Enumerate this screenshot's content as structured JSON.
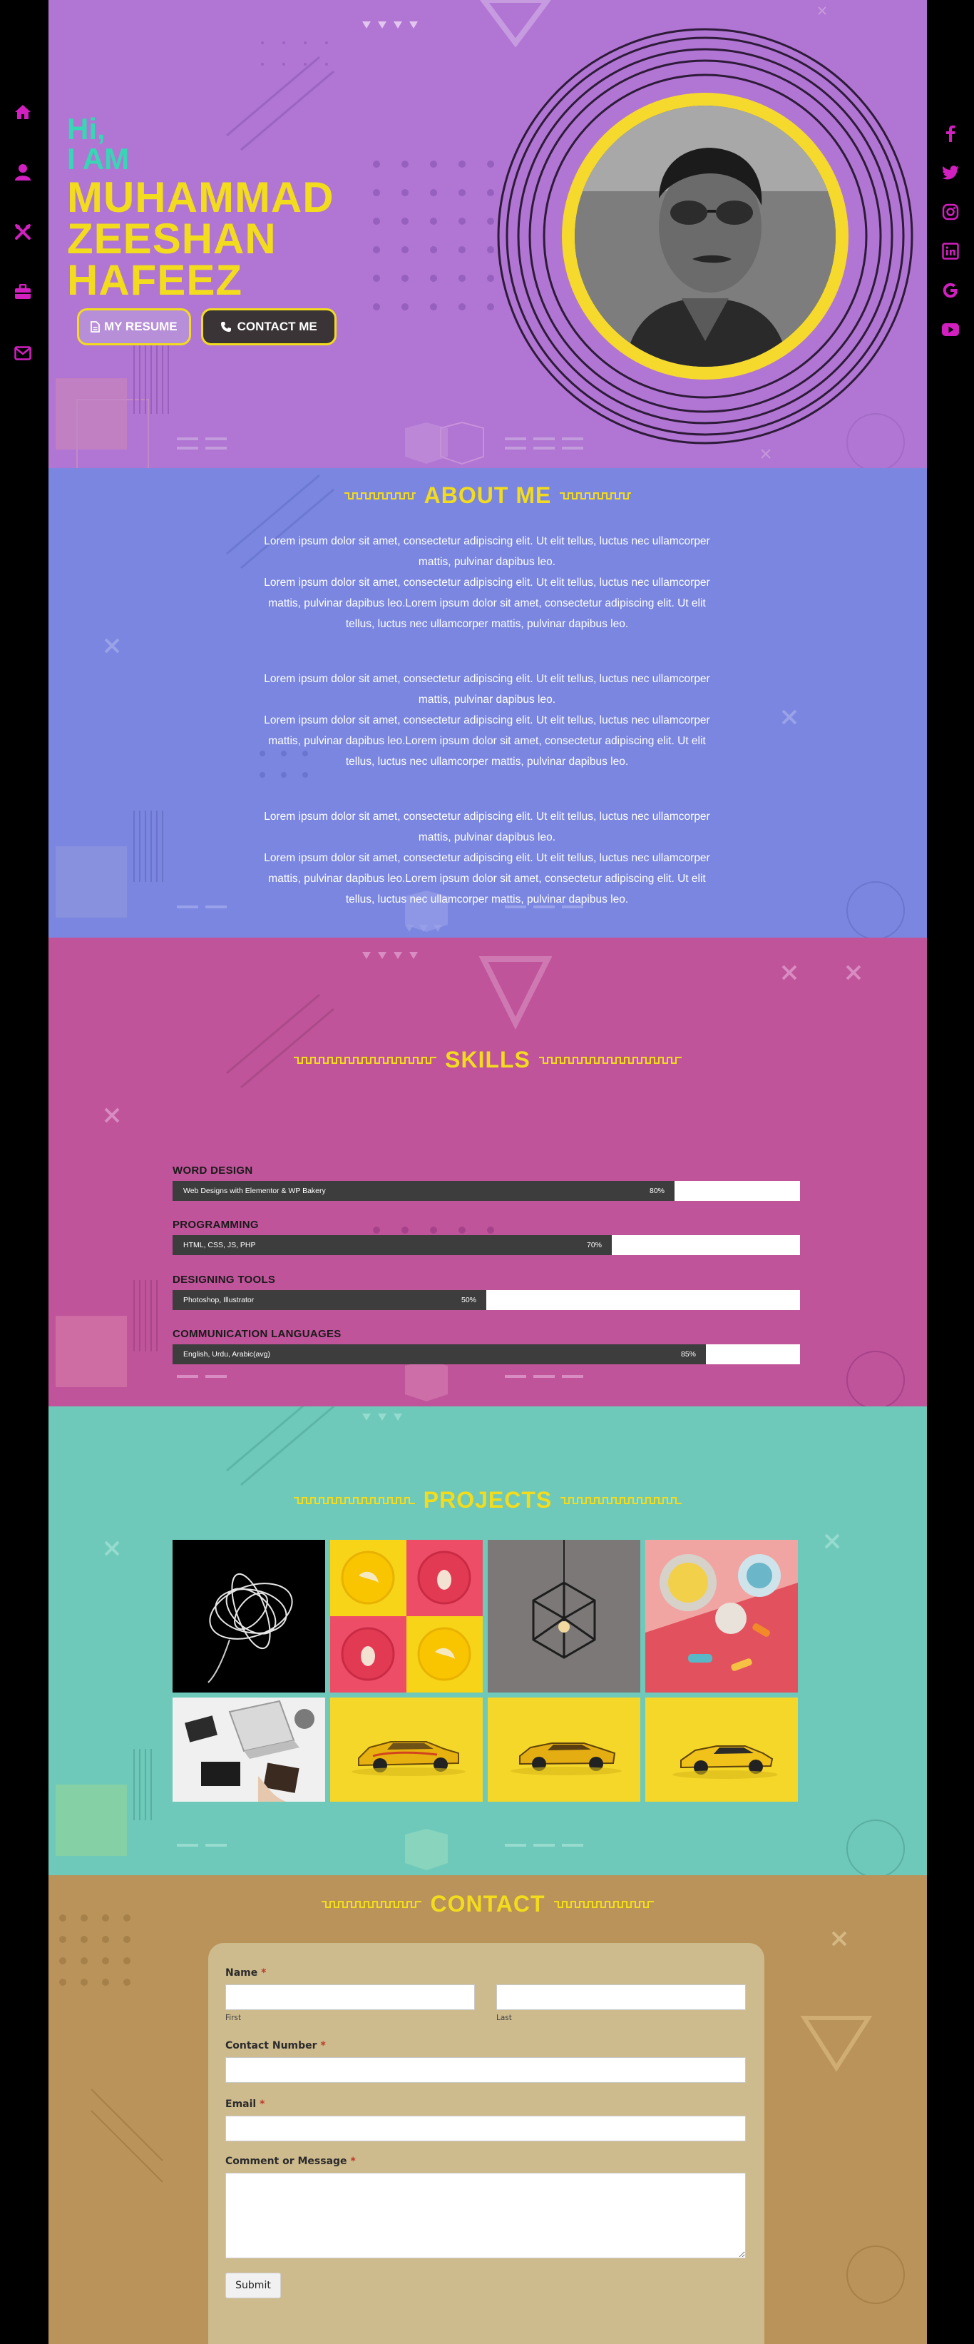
{
  "nav": {
    "left_items": [
      {
        "icon": "home-icon"
      },
      {
        "icon": "user-icon"
      },
      {
        "icon": "tools-icon"
      },
      {
        "icon": "briefcase-icon"
      },
      {
        "icon": "envelope-icon"
      }
    ],
    "right_items": [
      {
        "icon": "facebook-icon"
      },
      {
        "icon": "twitter-icon"
      },
      {
        "icon": "instagram-icon"
      },
      {
        "icon": "linkedin-icon"
      },
      {
        "icon": "google-icon"
      },
      {
        "icon": "youtube-icon"
      }
    ],
    "icon_color": "#d11fc0"
  },
  "hero": {
    "greeting": "Hi,",
    "iam": "I AM",
    "name_line1": "MUHAMMAD",
    "name_line2": "ZEESHAN",
    "name_line3": "HAFEEZ",
    "resume_label": "MY RESUME",
    "contact_label": "CONTACT ME"
  },
  "about": {
    "title": "ABOUT ME",
    "paragraphs": [
      {
        "line1": "Lorem ipsum dolor sit amet, consectetur adipiscing elit. Ut elit tellus, luctus nec ullamcorper mattis, pulvinar dapibus leo.",
        "line2": "Lorem ipsum dolor sit amet, consectetur adipiscing elit. Ut elit tellus, luctus nec ullamcorper mattis, pulvinar dapibus leo.Lorem ipsum dolor sit amet, consectetur adipiscing elit. Ut elit tellus, luctus nec ullamcorper mattis, pulvinar dapibus leo."
      },
      {
        "line1": "Lorem ipsum dolor sit amet, consectetur adipiscing elit. Ut elit tellus, luctus nec ullamcorper mattis, pulvinar dapibus leo.",
        "line2": "Lorem ipsum dolor sit amet, consectetur adipiscing elit. Ut elit tellus, luctus nec ullamcorper mattis, pulvinar dapibus leo.Lorem ipsum dolor sit amet, consectetur adipiscing elit. Ut elit tellus, luctus nec ullamcorper mattis, pulvinar dapibus leo."
      },
      {
        "line1": "Lorem ipsum dolor sit amet, consectetur adipiscing elit. Ut elit tellus, luctus nec ullamcorper mattis, pulvinar dapibus leo.",
        "line2": "Lorem ipsum dolor sit amet, consectetur adipiscing elit. Ut elit tellus, luctus nec ullamcorper mattis, pulvinar dapibus leo.Lorem ipsum dolor sit amet, consectetur adipiscing elit. Ut elit tellus, luctus nec ullamcorper mattis, pulvinar dapibus leo."
      }
    ]
  },
  "skills": {
    "title": "SKILLS",
    "items": [
      {
        "label": "WORD DESIGN",
        "description": "Web Designs with Elementor & WP Bakery",
        "percent": 80,
        "percent_text": "80%"
      },
      {
        "label": "PROGRAMMING",
        "description": "HTML, CSS, JS, PHP",
        "percent": 70,
        "percent_text": "70%"
      },
      {
        "label": "DESIGNING TOOLS",
        "description": "Photoshop, Illustrator",
        "percent": 50,
        "percent_text": "50%"
      },
      {
        "label": "COMMUNICATION LANGUAGES",
        "description": "English, Urdu, Arabic(avg)",
        "percent": 85,
        "percent_text": "85%"
      }
    ]
  },
  "projects": {
    "title": "PROJECTS",
    "items": [
      {
        "subject": "white-sculpture"
      },
      {
        "subject": "fruit-plates"
      },
      {
        "subject": "geometric-lamp"
      },
      {
        "subject": "colorful-bowls"
      },
      {
        "subject": "desk-workspace"
      },
      {
        "subject": "yellow-toy-car-1"
      },
      {
        "subject": "yellow-toy-car-2"
      },
      {
        "subject": "yellow-toy-car-3"
      }
    ]
  },
  "contact": {
    "title": "CONTACT",
    "name_label": "Name",
    "first_label": "First",
    "last_label": "Last",
    "number_label": "Contact Number",
    "email_label": "Email",
    "message_label": "Comment or Message",
    "required_mark": "*",
    "submit_label": "Submit"
  },
  "colors": {
    "hero_bg": "#b175d4",
    "about_bg": "#7a86e0",
    "skills_bg": "#c0549a",
    "projects_bg": "#6ec9ba",
    "contact_bg": "#b99359",
    "accent_yellow": "#f2dc1d",
    "accent_teal": "#37d6b5"
  }
}
